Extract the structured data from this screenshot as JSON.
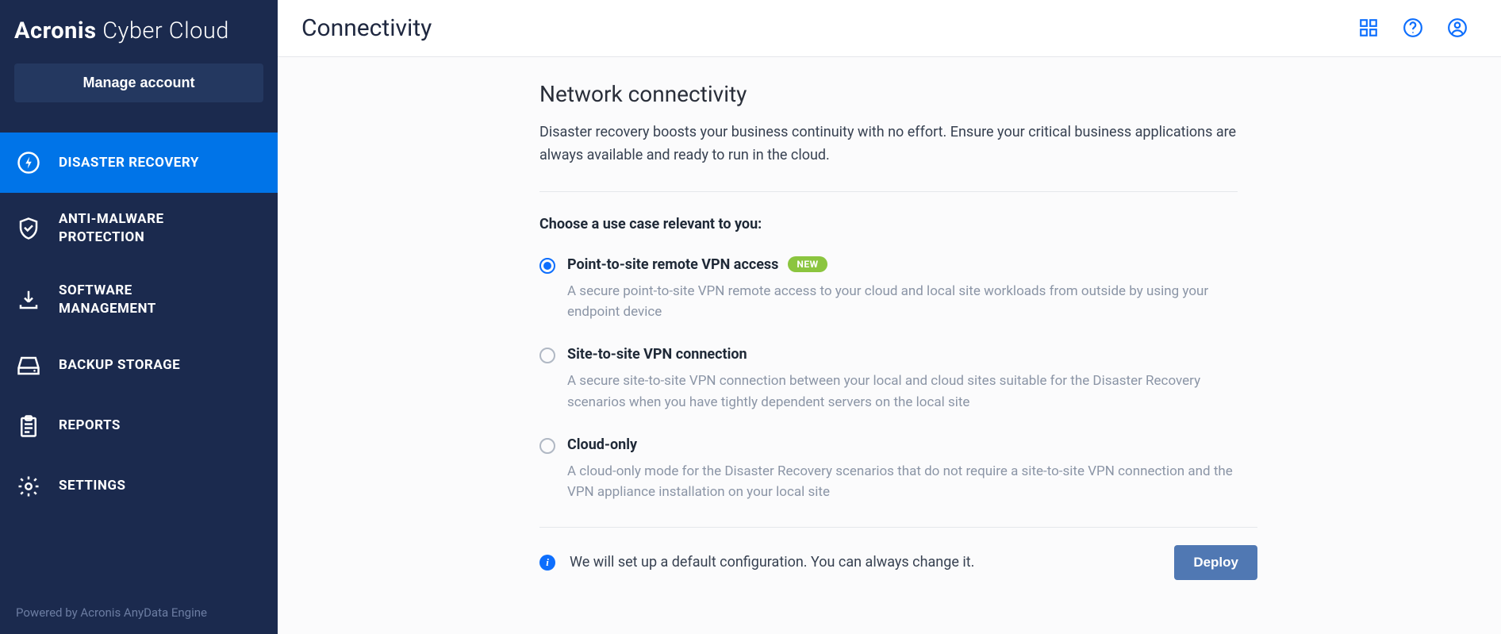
{
  "brand": {
    "bold": "Acronis",
    "light": "Cyber Cloud"
  },
  "sidebar": {
    "manage_label": "Manage account",
    "items": [
      {
        "label": "DISASTER RECOVERY",
        "icon": "bolt",
        "active": true
      },
      {
        "label": "ANTI-MALWARE PROTECTION",
        "icon": "shield",
        "active": false
      },
      {
        "label": "SOFTWARE MANAGEMENT",
        "icon": "download",
        "active": false
      },
      {
        "label": "BACKUP STORAGE",
        "icon": "drive",
        "active": false
      },
      {
        "label": "REPORTS",
        "icon": "clipboard",
        "active": false
      },
      {
        "label": "SETTINGS",
        "icon": "gear",
        "active": false
      }
    ],
    "footer": "Powered by Acronis AnyData Engine"
  },
  "header": {
    "title": "Connectivity"
  },
  "page": {
    "heading": "Network connectivity",
    "description": "Disaster recovery boosts your business continuity with no effort. Ensure your critical business applications are always available and ready to run in the cloud.",
    "choose_label": "Choose a use case relevant to you:",
    "options": [
      {
        "title": "Point-to-site remote VPN access",
        "badge": "NEW",
        "desc": "A secure point-to-site VPN remote access to your cloud and local site workloads from outside by using your endpoint device",
        "selected": true
      },
      {
        "title": "Site-to-site VPN connection",
        "badge": "",
        "desc": "A secure site-to-site VPN connection between your local and cloud sites suitable for the Disaster Recovery scenarios when you have tightly dependent servers on the local site",
        "selected": false
      },
      {
        "title": "Cloud-only",
        "badge": "",
        "desc": "A cloud-only mode for the Disaster Recovery scenarios that do not require a site-to-site VPN connection and the VPN appliance installation on your local site",
        "selected": false
      }
    ],
    "footer_info": "We will set up a default configuration. You can always change it.",
    "deploy_label": "Deploy"
  }
}
